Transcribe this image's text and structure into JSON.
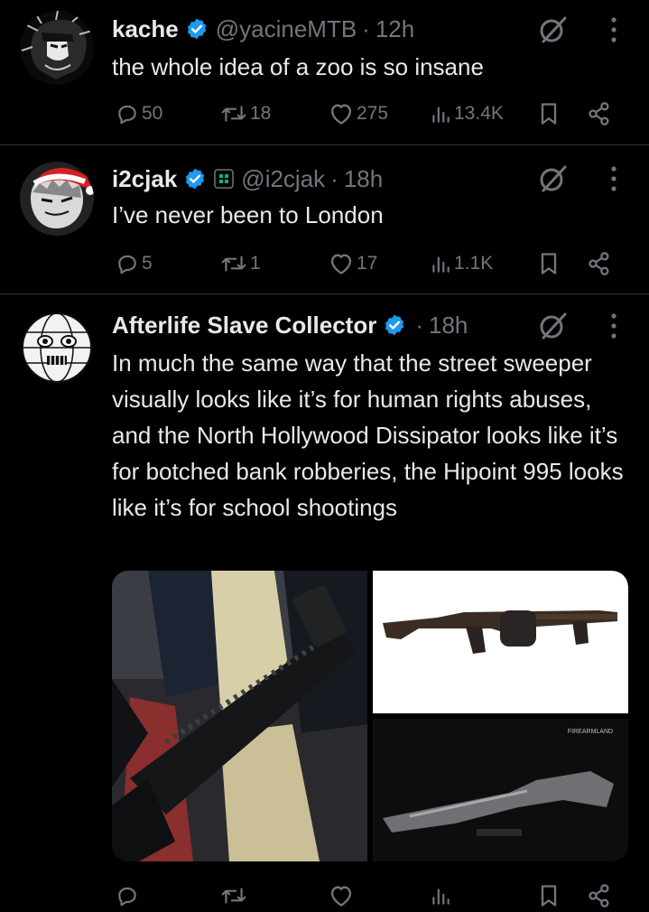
{
  "tweets": [
    {
      "name": "kache",
      "handle": "@yacineMTB",
      "dot": "·",
      "time": "12h",
      "text": "the whole idea of a zoo is so insane",
      "stats": {
        "replies": "50",
        "reposts": "18",
        "likes": "275",
        "views": "13.4K"
      }
    },
    {
      "name": "i2cjak",
      "handle": "@i2cjak",
      "dot": "·",
      "time": "18h",
      "text": "I’ve never been to London",
      "stats": {
        "replies": "5",
        "reposts": "1",
        "likes": "17",
        "views": "1.1K"
      }
    },
    {
      "name": "Afterlife Slave Collector",
      "dot": "·",
      "time": "18h",
      "text": "In much the same way that the street sweeper visually looks like it’s for human rights abuses, and the North Hollywood Dissipator looks like it’s for botched bank robberies, the Hipoint 995 looks like it’s for school shootings",
      "media": {
        "watermark": "FIREARMLAND"
      }
    }
  ],
  "colors": {
    "background": "#000000",
    "text": "#e7e9ea",
    "muted": "#71767b",
    "separator": "#2f3336",
    "verified": "#1d9bf0",
    "affiliate": "#00ba7c"
  },
  "icons": [
    "verified-badge-icon",
    "grok-icon",
    "more-icon",
    "reply-icon",
    "repost-icon",
    "like-icon",
    "views-icon",
    "bookmark-icon",
    "share-icon"
  ]
}
